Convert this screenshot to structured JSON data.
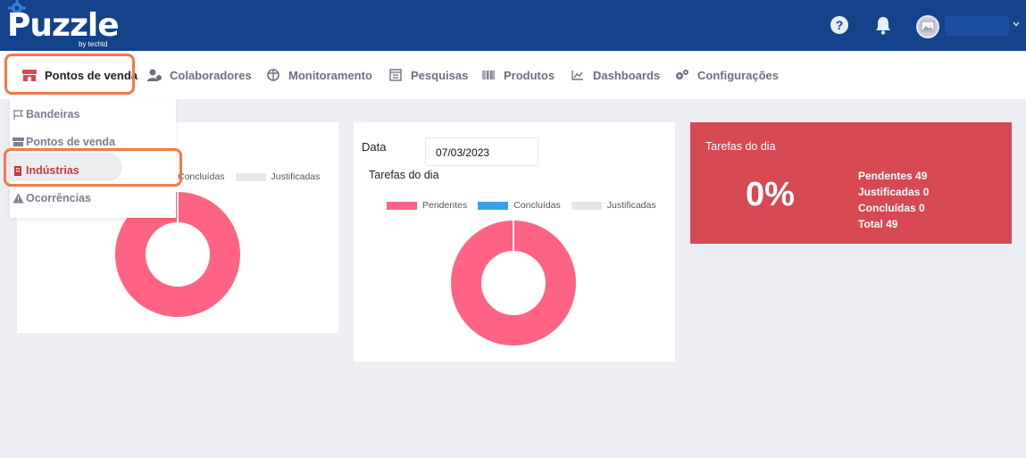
{
  "app": {
    "logo_text": "Puzzle",
    "logo_sub": "by techtd"
  },
  "topbar": {
    "help_symbol": "?",
    "icons": [
      "help-icon",
      "bell-icon",
      "avatar"
    ]
  },
  "nav": {
    "items": [
      {
        "label": "Pontos de venda",
        "icon": "store-icon",
        "active": true
      },
      {
        "label": "Colaboradores",
        "icon": "users-icon",
        "active": false
      },
      {
        "label": "Monitoramento",
        "icon": "globe-icon",
        "active": false
      },
      {
        "label": "Pesquisas",
        "icon": "survey-icon",
        "active": false
      },
      {
        "label": "Produtos",
        "icon": "barcode-icon",
        "active": false
      },
      {
        "label": "Dashboards",
        "icon": "chart-icon",
        "active": false
      },
      {
        "label": "Configurações",
        "icon": "gears-icon",
        "active": false
      }
    ]
  },
  "dropdown": {
    "items": [
      {
        "label": "Bandeiras",
        "icon": "flag-icon",
        "selected": false
      },
      {
        "label": "Pontos de venda",
        "icon": "store-icon",
        "selected": false
      },
      {
        "label": "Indústrias",
        "icon": "industry-icon",
        "selected": true
      },
      {
        "label": "Ocorrências",
        "icon": "warning-icon",
        "selected": false
      }
    ]
  },
  "card1": {
    "legend": {
      "concluidas": "Concluídas",
      "justificadas": "Justificadas"
    }
  },
  "card2": {
    "date_label": "Data",
    "date_value": "07/03/2023",
    "title": "Tarefas do dia",
    "legend": {
      "pendentes": "Pendentes",
      "concluidas": "Concluídas",
      "justificadas": "Justificadas"
    }
  },
  "card3": {
    "title": "Tarefas do dia",
    "percent": "0%",
    "stats": {
      "pendentes": "Pendentes 49",
      "justificadas": "Justificadas 0",
      "concluidas": "Concluídas 0",
      "total": "Total 49"
    }
  },
  "colors": {
    "topbar": "#14428b",
    "accent_orange": "#f07a45",
    "pendentes": "#ff6384",
    "concluidas": "#36a2eb",
    "justificadas": "#e6e6e6",
    "card_red": "#d64852",
    "selected_text": "#c43a3a"
  },
  "chart_data": [
    {
      "type": "pie",
      "categories": [
        "Pendentes",
        "Concluídas",
        "Justificadas"
      ],
      "values": [
        49,
        0,
        0
      ],
      "donut": true
    },
    {
      "type": "pie",
      "title": "Tarefas do dia",
      "categories": [
        "Pendentes",
        "Concluídas",
        "Justificadas"
      ],
      "values": [
        49,
        0,
        0
      ],
      "donut": true
    }
  ]
}
